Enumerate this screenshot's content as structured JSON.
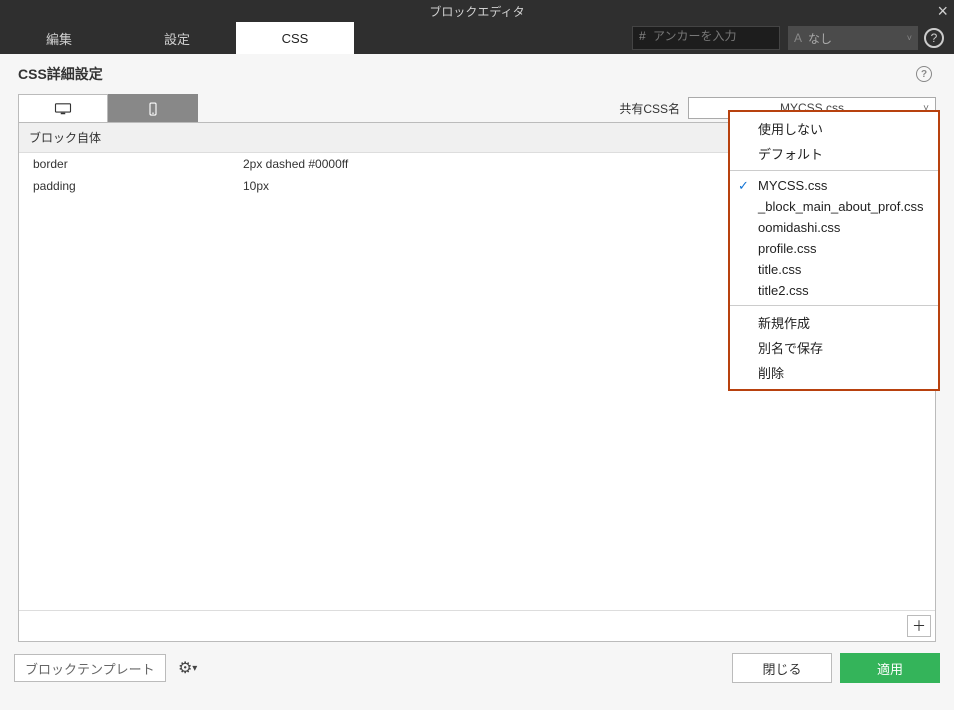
{
  "title": "ブロックエディタ",
  "tabs": {
    "edit": "編集",
    "settings": "設定",
    "css": "CSS"
  },
  "anchor": {
    "prefix": "#",
    "placeholder": "アンカーを入力"
  },
  "toolbar_select": {
    "label": "なし"
  },
  "subheading": "CSS詳細設定",
  "shared": {
    "label": "共有CSS名",
    "value": "MYCSS.css"
  },
  "section": {
    "heading": "ブロック自体"
  },
  "props": [
    {
      "name": "border",
      "value": "2px dashed #0000ff"
    },
    {
      "name": "padding",
      "value": "10px"
    }
  ],
  "menu": {
    "group1": [
      "使用しない",
      "デフォルト"
    ],
    "group2": [
      "MYCSS.css",
      "_block_main_about_prof.css",
      "oomidashi.css",
      "profile.css",
      "title.css",
      "title2.css"
    ],
    "selected": "MYCSS.css",
    "group3": [
      "新規作成",
      "別名で保存",
      "削除"
    ]
  },
  "footer": {
    "template": "ブロックテンプレート",
    "close": "閉じる",
    "apply": "適用"
  }
}
